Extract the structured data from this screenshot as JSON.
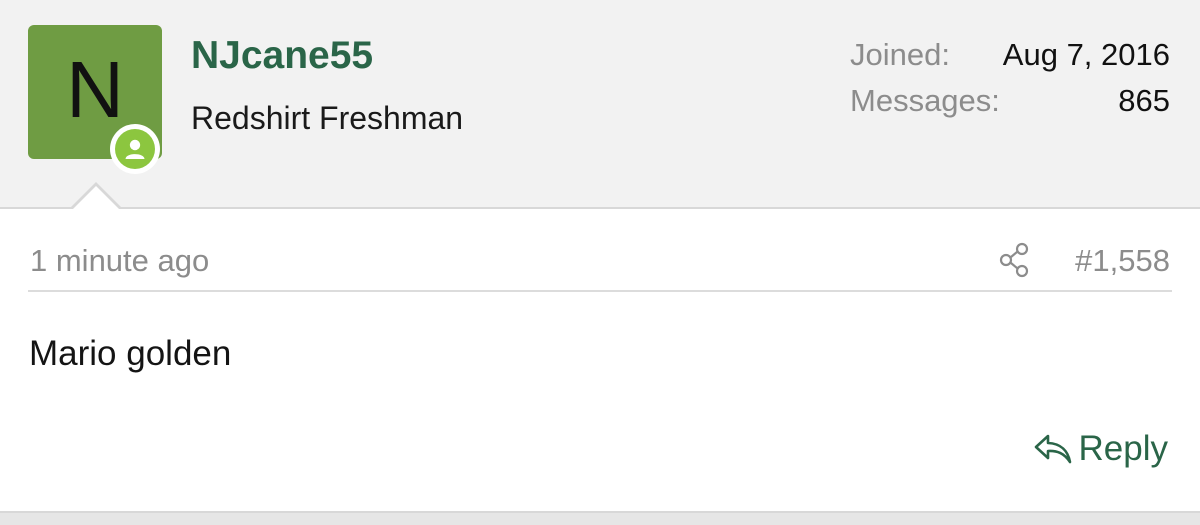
{
  "colors": {
    "avatar_bg": "#6f9c43",
    "online_badge": "#8cc63f",
    "username": "#2a6548",
    "reply": "#2a6548"
  },
  "user": {
    "avatar_letter": "N",
    "name": "NJcane55",
    "title": "Redshirt Freshman",
    "online_icon": "user-online-icon",
    "stats": [
      {
        "label": "Joined:",
        "value": "Aug 7, 2016"
      },
      {
        "label": "Messages:",
        "value": "865"
      }
    ]
  },
  "post": {
    "timestamp": "1 minute ago",
    "share_icon": "share-icon",
    "number": "#1,558",
    "body": "Mario golden"
  },
  "actions": {
    "reply_icon": "reply-arrow-icon",
    "reply_label": "Reply"
  }
}
